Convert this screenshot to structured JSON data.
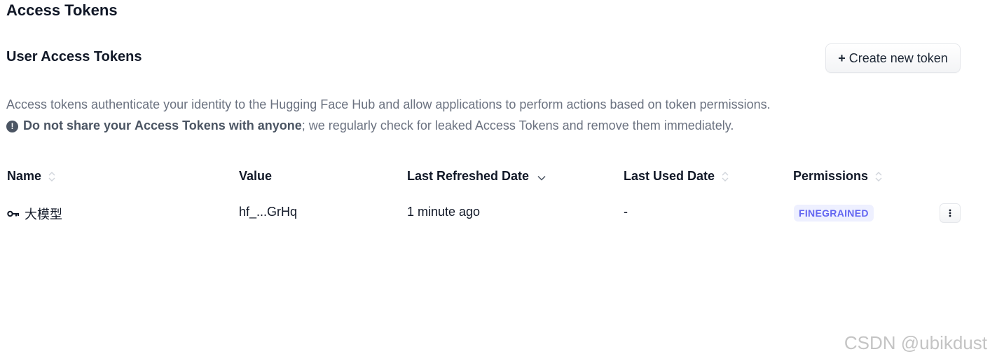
{
  "page": {
    "title": "Access Tokens"
  },
  "section": {
    "title": "User Access Tokens",
    "create_button_label": "Create new token",
    "create_button_icon": "plus-icon"
  },
  "description": "Access tokens authenticate your identity to the Hugging Face Hub and allow applications to perform actions based on token permissions.",
  "warning": {
    "icon": "alert-circle-icon",
    "bold_text": "Do not share your ",
    "bold_emphasis": "Access Tokens",
    "bold_tail": " with anyone",
    "rest": "; we regularly check for leaked Access Tokens and remove them immediately."
  },
  "table": {
    "columns": [
      {
        "label": "Name",
        "sortable": true,
        "sort_state": "none"
      },
      {
        "label": "Value",
        "sortable": false
      },
      {
        "label": "Last Refreshed Date",
        "sortable": true,
        "sort_state": "descending"
      },
      {
        "label": "Last Used Date",
        "sortable": true,
        "sort_state": "none"
      },
      {
        "label": "Permissions",
        "sortable": true,
        "sort_state": "none"
      }
    ],
    "rows": [
      {
        "icon": "key-icon",
        "name": "大模型",
        "value": "hf_...GrHq",
        "last_refreshed": "1 minute ago",
        "last_used": "-",
        "permission": "FINEGRAINED",
        "menu_icon": "more-vertical-icon"
      }
    ]
  },
  "colors": {
    "badge_bg": "#eef0ff",
    "badge_text": "#6366f1",
    "muted_text": "#6b7280"
  },
  "watermark": "CSDN @ubikdust"
}
